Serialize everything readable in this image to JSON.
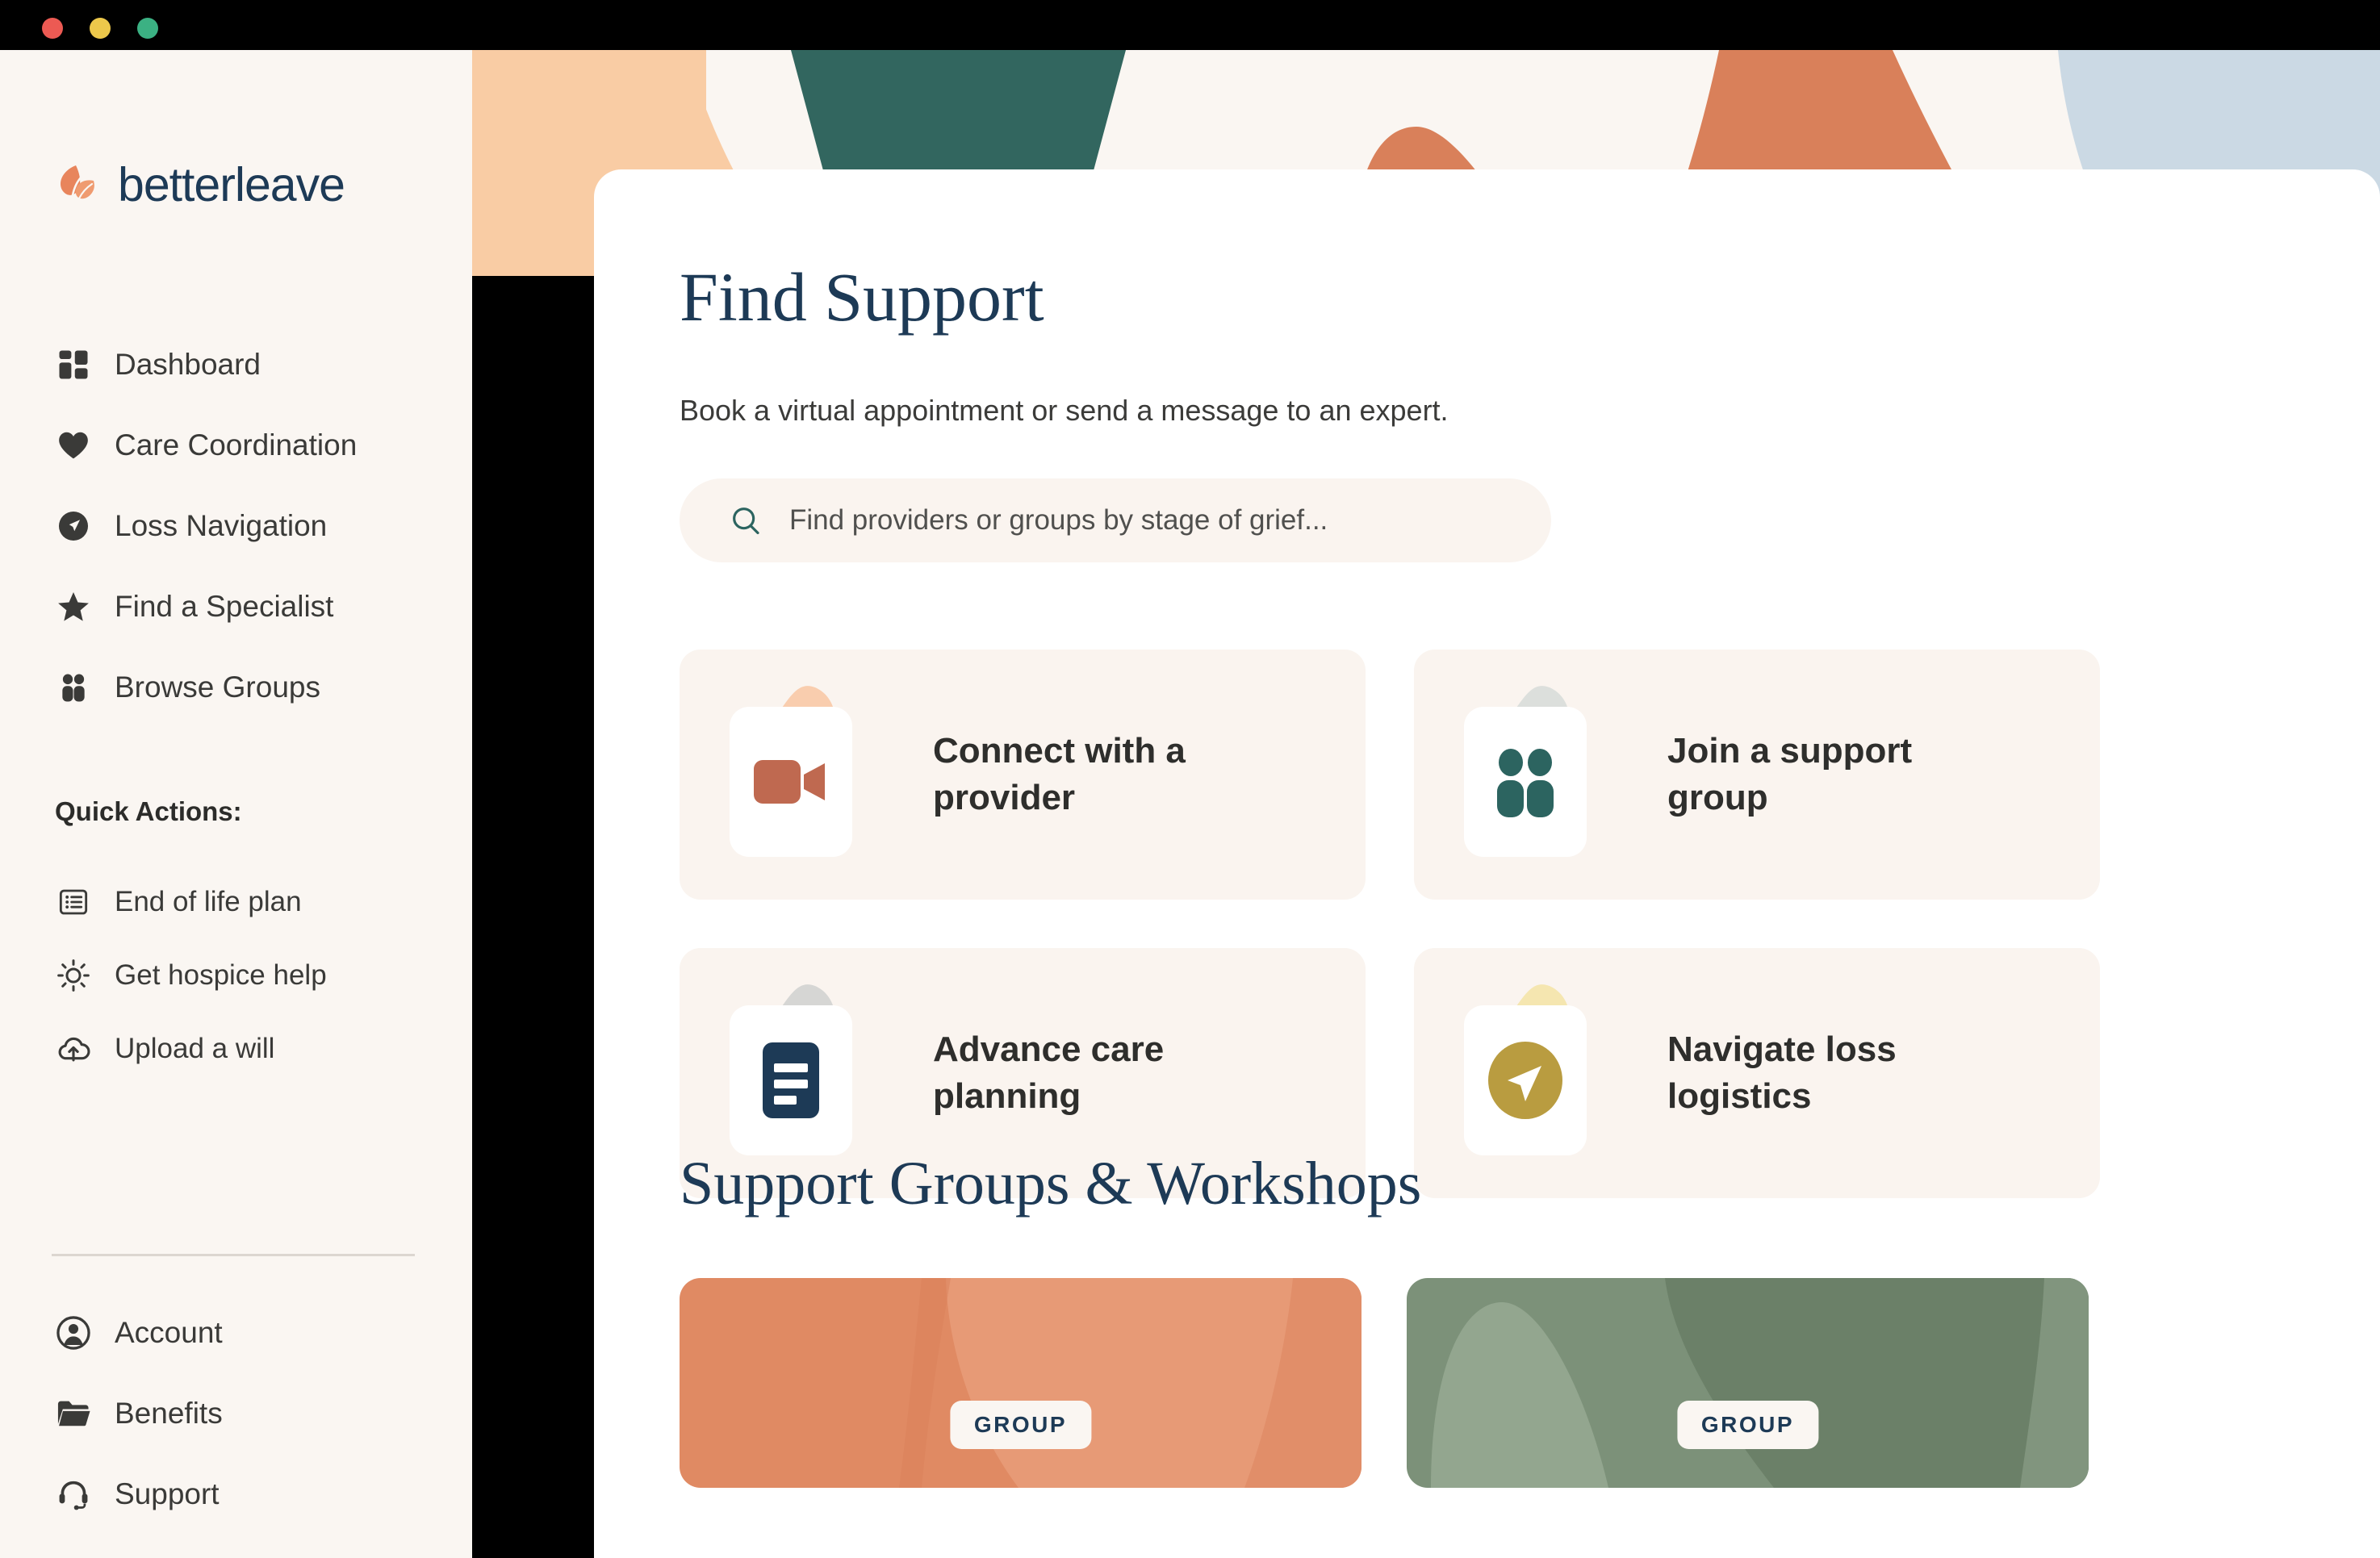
{
  "window": {
    "controls": [
      "close",
      "minimize",
      "maximize"
    ],
    "colors": {
      "close": "#ec5a53",
      "minimize": "#edc84b",
      "maximize": "#3bb183"
    }
  },
  "brand": {
    "name": "betterleave",
    "mark_color": "#e8855c",
    "text_color": "#1d3a56"
  },
  "sidebar": {
    "nav": [
      {
        "label": "Dashboard",
        "icon": "dashboard-grid-icon"
      },
      {
        "label": "Care Coordination",
        "icon": "heart-icon"
      },
      {
        "label": "Loss Navigation",
        "icon": "compass-navigate-icon"
      },
      {
        "label": "Find a Specialist",
        "icon": "star-icon"
      },
      {
        "label": "Browse Groups",
        "icon": "people-group-icon"
      }
    ],
    "quick_actions_heading": "Quick Actions:",
    "quick_actions": [
      {
        "label": "End of life plan",
        "icon": "list-document-icon"
      },
      {
        "label": "Get hospice help",
        "icon": "sun-icon"
      },
      {
        "label": "Upload a will",
        "icon": "cloud-upload-icon"
      }
    ],
    "bottom": [
      {
        "label": "Account",
        "icon": "account-avatar-icon"
      },
      {
        "label": "Benefits",
        "icon": "folder-icon"
      },
      {
        "label": "Support",
        "icon": "headset-icon"
      }
    ]
  },
  "main": {
    "title": "Find Support",
    "subtitle": "Book a virtual appointment or send a message to an expert.",
    "search": {
      "placeholder": "Find providers or groups by stage of grief...",
      "icon": "search-icon"
    },
    "action_cards": [
      {
        "label": "Connect with a provider",
        "icon": "video-camera-icon",
        "blob_color": "#f9cdae",
        "icon_color": "#bf6950"
      },
      {
        "label": "Join a support group",
        "icon": "people-group-icon",
        "blob_color": "#dcdfdc",
        "icon_color": "#2c6460"
      },
      {
        "label": "Advance care planning",
        "icon": "document-lines-icon",
        "blob_color": "#d6d6d4",
        "icon_color": "#1d3a56"
      },
      {
        "label": "Navigate loss logistics",
        "icon": "compass-navigate-icon",
        "blob_color": "#f5e6b0",
        "icon_color": "#b99c40"
      }
    ],
    "section2_title": "Support Groups & Workshops",
    "group_cards": [
      {
        "badge": "GROUP",
        "bg": "#e08a63",
        "accent_light": "#e79a76",
        "accent_dark": "#d9805a"
      },
      {
        "badge": "GROUP",
        "bg": "#7c9179",
        "accent_light": "#93a68f",
        "accent_dark": "#6b8068"
      }
    ]
  },
  "banner": {
    "bg": "#faf6f2",
    "shapes": [
      {
        "name": "peach-block",
        "color": "#f9cca4"
      },
      {
        "name": "teal-arch",
        "color": "#32665f"
      },
      {
        "name": "terracotta-arch-small",
        "color": "#d9805a"
      },
      {
        "name": "terracotta-arch-large",
        "color": "#d9805a"
      },
      {
        "name": "blue-blob",
        "color": "#cbd9e4"
      }
    ]
  }
}
